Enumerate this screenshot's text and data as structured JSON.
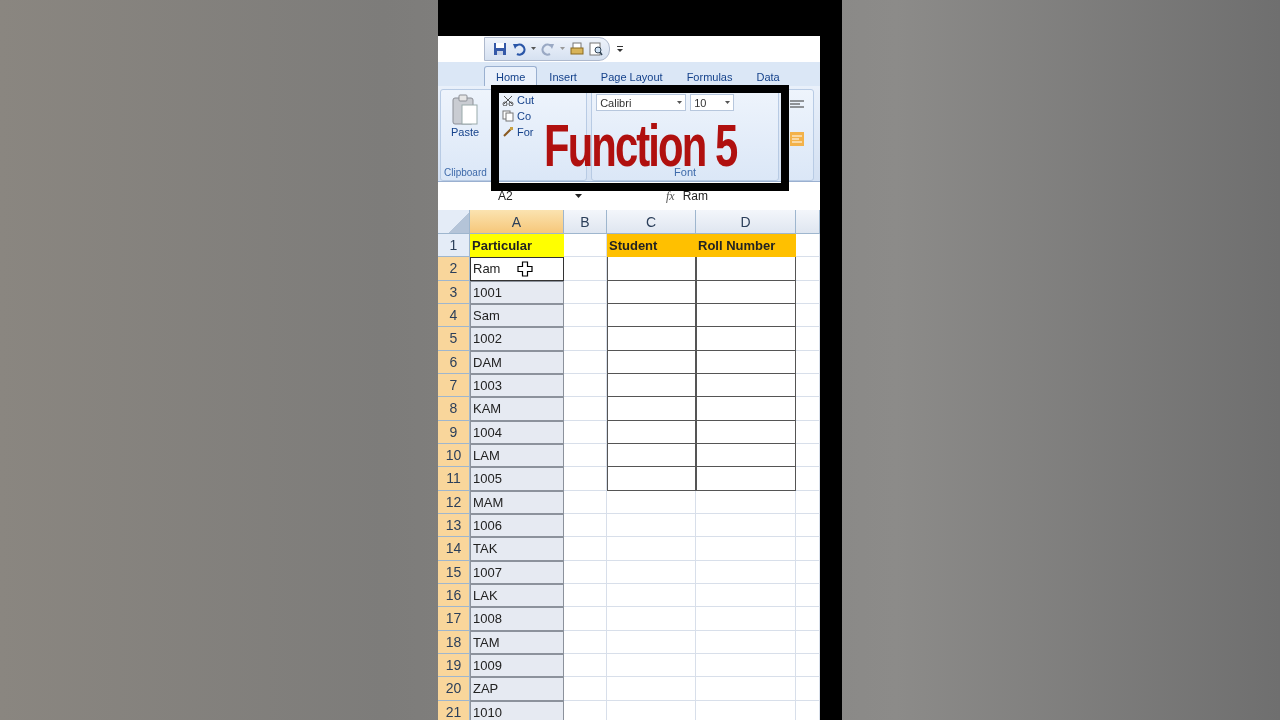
{
  "tabs": [
    {
      "label": "Home",
      "selected": true
    },
    {
      "label": "Insert",
      "selected": false
    },
    {
      "label": "Page Layout",
      "selected": false
    },
    {
      "label": "Formulas",
      "selected": false
    },
    {
      "label": "Data",
      "selected": false
    }
  ],
  "ribbon": {
    "clipboard": {
      "paste": "Paste",
      "items": [
        "Cut",
        "Co",
        "For"
      ],
      "label": "Clipboard"
    },
    "font": {
      "font_name": "Calibri",
      "font_size": "10",
      "label": "Font"
    }
  },
  "formula_bar": {
    "name_box": "A2",
    "function_label": "fx",
    "value": "Ram"
  },
  "overlay_title": "Function 5",
  "sheet": {
    "columns": [
      {
        "label": "A",
        "selected": true
      },
      {
        "label": "B",
        "selected": false
      },
      {
        "label": "C",
        "selected": false
      },
      {
        "label": "D",
        "selected": false
      }
    ],
    "header_row": {
      "number": "1",
      "selected": false,
      "cells": [
        {
          "text": "Particular",
          "color": "#ffff00"
        },
        null,
        {
          "text": "Student",
          "color": "#ffc000"
        },
        {
          "text": "Roll Number",
          "color": "#ffc000"
        }
      ]
    },
    "rows": [
      {
        "number": "2",
        "value": "Ram",
        "selected": true,
        "active": true,
        "in_table": true
      },
      {
        "number": "3",
        "value": "1001",
        "selected": true,
        "active": false,
        "in_table": true
      },
      {
        "number": "4",
        "value": "Sam",
        "selected": true,
        "active": false,
        "in_table": true
      },
      {
        "number": "5",
        "value": "1002",
        "selected": true,
        "active": false,
        "in_table": true
      },
      {
        "number": "6",
        "value": "DAM",
        "selected": true,
        "active": false,
        "in_table": true
      },
      {
        "number": "7",
        "value": "1003",
        "selected": true,
        "active": false,
        "in_table": true
      },
      {
        "number": "8",
        "value": "KAM",
        "selected": true,
        "active": false,
        "in_table": true
      },
      {
        "number": "9",
        "value": "1004",
        "selected": true,
        "active": false,
        "in_table": true
      },
      {
        "number": "10",
        "value": "LAM",
        "selected": true,
        "active": false,
        "in_table": true
      },
      {
        "number": "11",
        "value": "1005",
        "selected": true,
        "active": false,
        "in_table": true
      },
      {
        "number": "12",
        "value": "MAM",
        "selected": true,
        "active": false,
        "in_table": false
      },
      {
        "number": "13",
        "value": "1006",
        "selected": true,
        "active": false,
        "in_table": false
      },
      {
        "number": "14",
        "value": "TAK",
        "selected": true,
        "active": false,
        "in_table": false
      },
      {
        "number": "15",
        "value": "1007",
        "selected": true,
        "active": false,
        "in_table": false
      },
      {
        "number": "16",
        "value": "LAK",
        "selected": true,
        "active": false,
        "in_table": false
      },
      {
        "number": "17",
        "value": "1008",
        "selected": true,
        "active": false,
        "in_table": false
      },
      {
        "number": "18",
        "value": "TAM",
        "selected": true,
        "active": false,
        "in_table": false
      },
      {
        "number": "19",
        "value": "1009",
        "selected": true,
        "active": false,
        "in_table": false
      },
      {
        "number": "20",
        "value": "ZAP",
        "selected": true,
        "active": false,
        "in_table": false
      },
      {
        "number": "21",
        "value": "1010",
        "selected": true,
        "active": false,
        "in_table": false
      }
    ]
  }
}
